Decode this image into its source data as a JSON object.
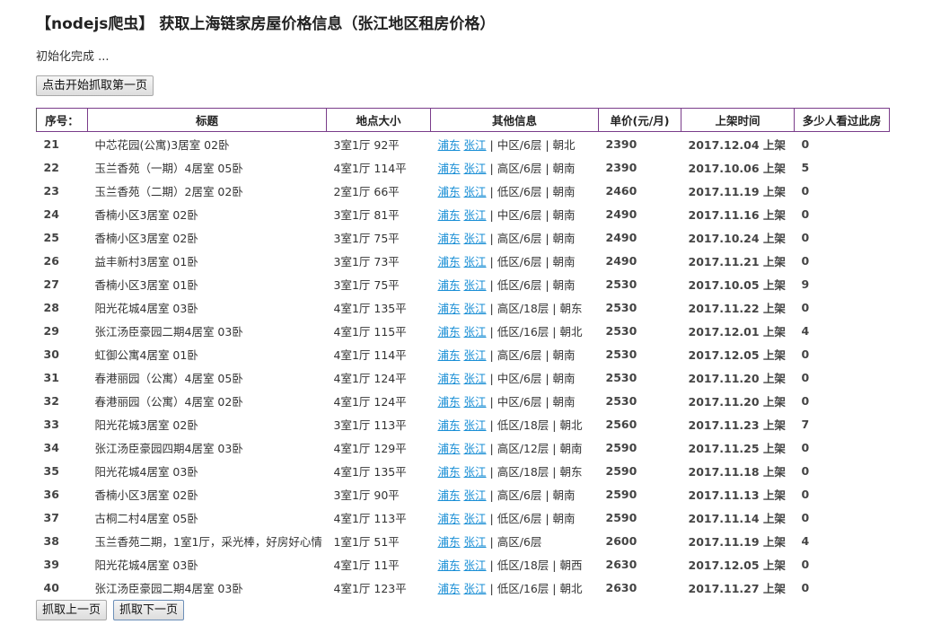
{
  "header": {
    "title": "【nodejs爬虫】 获取上海链家房屋价格信息（张江地区租房价格）",
    "status": "初始化完成 ..."
  },
  "buttons": {
    "start": "点击开始抓取第一页",
    "prev": "抓取上一页",
    "next": "抓取下一页"
  },
  "table": {
    "columns": [
      "序号：",
      "标题",
      "地点大小",
      "其他信息",
      "单价(元/月)",
      "上架时间",
      "多少人看过此房"
    ],
    "rows": [
      {
        "id": "21",
        "title": "中芯花园(公寓)3居室 02卧",
        "size": "3室1厅  92平",
        "district": "浦东",
        "area": "张江",
        "info": "中区/6层 | 朝北",
        "price": "2390",
        "date": "2017.12.04 上架",
        "views": "0"
      },
      {
        "id": "22",
        "title": "玉兰香苑（一期）4居室 05卧",
        "size": "4室1厅  114平",
        "district": "浦东",
        "area": "张江",
        "info": "高区/6层 | 朝南",
        "price": "2390",
        "date": "2017.10.06 上架",
        "views": "5"
      },
      {
        "id": "23",
        "title": "玉兰香苑（二期）2居室 02卧",
        "size": "2室1厅  66平",
        "district": "浦东",
        "area": "张江",
        "info": "低区/6层 | 朝南",
        "price": "2460",
        "date": "2017.11.19 上架",
        "views": "0"
      },
      {
        "id": "24",
        "title": "香楠小区3居室 02卧",
        "size": "3室1厅  81平",
        "district": "浦东",
        "area": "张江",
        "info": "中区/6层 | 朝南",
        "price": "2490",
        "date": "2017.11.16 上架",
        "views": "0"
      },
      {
        "id": "25",
        "title": "香楠小区3居室 02卧",
        "size": "3室1厅  75平",
        "district": "浦东",
        "area": "张江",
        "info": "高区/6层 | 朝南",
        "price": "2490",
        "date": "2017.10.24 上架",
        "views": "0"
      },
      {
        "id": "26",
        "title": "益丰新村3居室 01卧",
        "size": "3室1厅  73平",
        "district": "浦东",
        "area": "张江",
        "info": "低区/6层 | 朝南",
        "price": "2490",
        "date": "2017.11.21 上架",
        "views": "0"
      },
      {
        "id": "27",
        "title": "香楠小区3居室 01卧",
        "size": "3室1厅  75平",
        "district": "浦东",
        "area": "张江",
        "info": "低区/6层 | 朝南",
        "price": "2530",
        "date": "2017.10.05 上架",
        "views": "9"
      },
      {
        "id": "28",
        "title": "阳光花城4居室 03卧",
        "size": "4室1厅  135平",
        "district": "浦东",
        "area": "张江",
        "info": "高区/18层 | 朝东",
        "price": "2530",
        "date": "2017.11.22 上架",
        "views": "0"
      },
      {
        "id": "29",
        "title": "张江汤臣豪园二期4居室 03卧",
        "size": "4室1厅  115平",
        "district": "浦东",
        "area": "张江",
        "info": "低区/16层 | 朝北",
        "price": "2530",
        "date": "2017.12.01 上架",
        "views": "4"
      },
      {
        "id": "30",
        "title": "虹御公寓4居室 01卧",
        "size": "4室1厅  114平",
        "district": "浦东",
        "area": "张江",
        "info": "高区/6层 | 朝南",
        "price": "2530",
        "date": "2017.12.05 上架",
        "views": "0"
      },
      {
        "id": "31",
        "title": "春港丽园（公寓）4居室 05卧",
        "size": "4室1厅  124平",
        "district": "浦东",
        "area": "张江",
        "info": "中区/6层 | 朝南",
        "price": "2530",
        "date": "2017.11.20 上架",
        "views": "0"
      },
      {
        "id": "32",
        "title": "春港丽园（公寓）4居室 02卧",
        "size": "4室1厅  124平",
        "district": "浦东",
        "area": "张江",
        "info": "中区/6层 | 朝南",
        "price": "2530",
        "date": "2017.11.20 上架",
        "views": "0"
      },
      {
        "id": "33",
        "title": "阳光花城3居室 02卧",
        "size": "3室1厅  113平",
        "district": "浦东",
        "area": "张江",
        "info": "低区/18层 | 朝北",
        "price": "2560",
        "date": "2017.11.23 上架",
        "views": "7"
      },
      {
        "id": "34",
        "title": "张江汤臣豪园四期4居室 03卧",
        "size": "4室1厅  129平",
        "district": "浦东",
        "area": "张江",
        "info": "高区/12层 | 朝南",
        "price": "2590",
        "date": "2017.11.25 上架",
        "views": "0"
      },
      {
        "id": "35",
        "title": "阳光花城4居室 03卧",
        "size": "4室1厅  135平",
        "district": "浦东",
        "area": "张江",
        "info": "高区/18层 | 朝东",
        "price": "2590",
        "date": "2017.11.18 上架",
        "views": "0"
      },
      {
        "id": "36",
        "title": "香楠小区3居室 02卧",
        "size": "3室1厅  90平",
        "district": "浦东",
        "area": "张江",
        "info": "高区/6层 | 朝南",
        "price": "2590",
        "date": "2017.11.13 上架",
        "views": "0"
      },
      {
        "id": "37",
        "title": "古桐二村4居室 05卧",
        "size": "4室1厅  113平",
        "district": "浦东",
        "area": "张江",
        "info": "低区/6层 | 朝南",
        "price": "2590",
        "date": "2017.11.14 上架",
        "views": "0"
      },
      {
        "id": "38",
        "title": "玉兰香苑二期，1室1厅，采光棒，好房好心情",
        "size": "1室1厅  51平",
        "district": "浦东",
        "area": "张江",
        "info": "高区/6层",
        "price": "2600",
        "date": "2017.11.19 上架",
        "views": "4"
      },
      {
        "id": "39",
        "title": "阳光花城4居室 03卧",
        "size": "4室1厅  11平",
        "district": "浦东",
        "area": "张江",
        "info": "低区/18层 | 朝西",
        "price": "2630",
        "date": "2017.12.05 上架",
        "views": "0"
      },
      {
        "id": "40",
        "title": "张江汤臣豪园二期4居室 03卧",
        "size": "4室1厅  123平",
        "district": "浦东",
        "area": "张江",
        "info": "低区/16层 | 朝北",
        "price": "2630",
        "date": "2017.11.27 上架",
        "views": "0"
      }
    ]
  }
}
